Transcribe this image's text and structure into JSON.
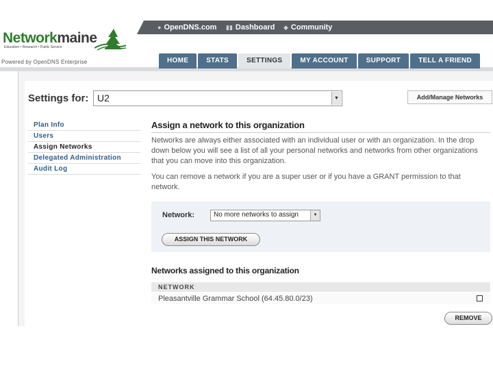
{
  "topnav": {
    "items": [
      {
        "label": "OpenDNS.com",
        "icon": "opendns-icon"
      },
      {
        "label": "Dashboard",
        "icon": "bar-chart-icon"
      },
      {
        "label": "Community",
        "icon": "community-icon"
      }
    ]
  },
  "brand": {
    "name_part1": "Network",
    "name_part2": "maine",
    "tagline": "Education • Research • Public Service",
    "powered_by": "Powered by OpenDNS Enterprise",
    "colors": {
      "green": "#2f7c2c",
      "dark": "#3a3a3a"
    }
  },
  "tabs": [
    {
      "label": "HOME",
      "active": false
    },
    {
      "label": "STATS",
      "active": false
    },
    {
      "label": "SETTINGS",
      "active": true
    },
    {
      "label": "MY ACCOUNT",
      "active": false
    },
    {
      "label": "SUPPORT",
      "active": false
    },
    {
      "label": "TELL A FRIEND",
      "active": false
    }
  ],
  "settings": {
    "label": "Settings for:",
    "selected_org": "U2",
    "add_manage_label": "Add/Manage Networks"
  },
  "sidenav": [
    {
      "label": "Plan Info",
      "current": false
    },
    {
      "label": "Users",
      "current": false
    },
    {
      "label": "Assign Networks",
      "current": true
    },
    {
      "label": "Delegated Administration",
      "current": false
    },
    {
      "label": "Audit Log",
      "current": false
    }
  ],
  "main": {
    "heading": "Assign a network to this organization",
    "para1": "Networks are always either associated with an individual user or with an organization. In the drop down below you will see a list of all your personal networks and networks from other organizations that you can move into this organization.",
    "para2": "You can remove a network if you are a super user or if you have a GRANT permission to that network.",
    "network_label": "Network:",
    "network_select_value": "No more networks to assign",
    "assign_button": "ASSIGN THIS NETWORK",
    "assigned_heading": "Networks assigned to this organization",
    "table_header": "NETWORK",
    "rows": [
      {
        "name": "Pleasantville Grammar School (64.45.80.0/23)",
        "checked": false
      }
    ],
    "remove_button": "REMOVE"
  }
}
